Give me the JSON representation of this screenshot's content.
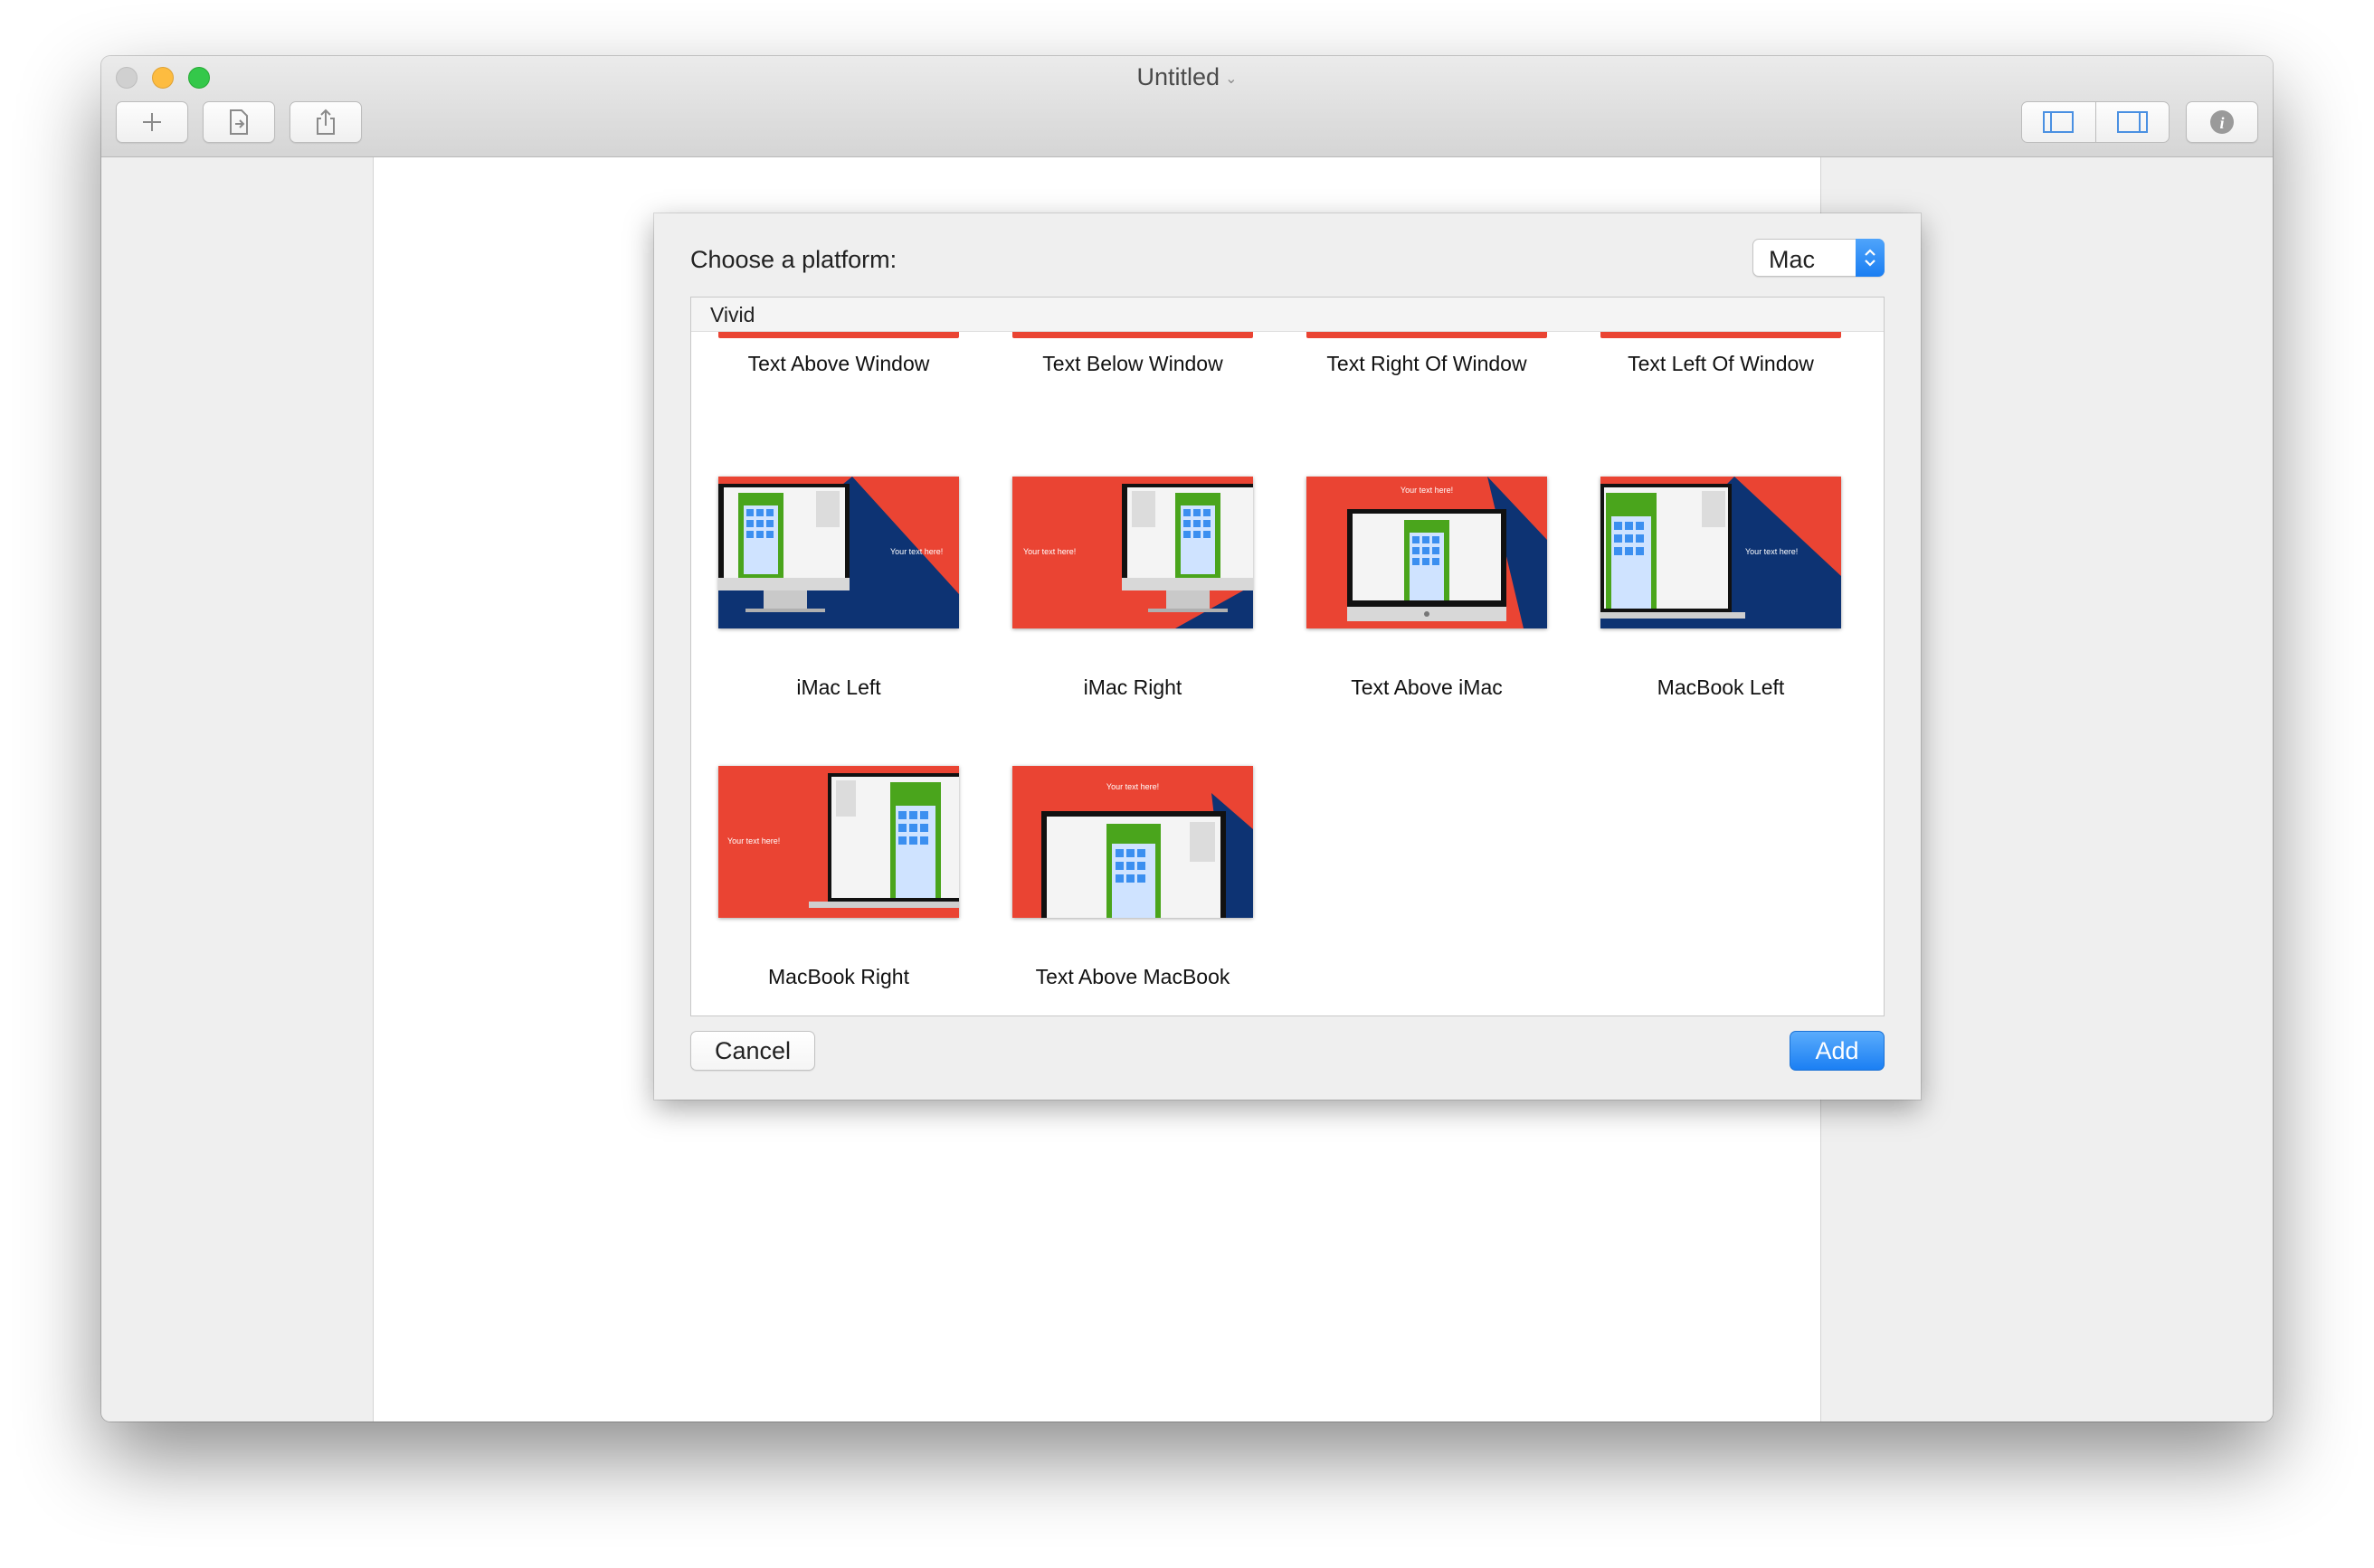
{
  "window": {
    "title": "Untitled"
  },
  "toolbar": {
    "add_icon": "plus-icon",
    "export_icon": "export-document-icon",
    "share_icon": "share-icon",
    "left_panel_icon": "left-sidebar-icon",
    "right_panel_icon": "right-sidebar-icon",
    "info_icon": "info-icon"
  },
  "sheet": {
    "label": "Choose a platform:",
    "platform": "Mac",
    "group": "Vivid",
    "cancel_label": "Cancel",
    "add_label": "Add",
    "top_row": [
      "Text Above Window",
      "Text Below Window",
      "Text Right Of Window",
      "Text Left Of Window"
    ],
    "templates": [
      {
        "label": "iMac Left",
        "caption": "Your text here!"
      },
      {
        "label": "iMac Right",
        "caption": "Your text here!"
      },
      {
        "label": "Text Above iMac",
        "caption": "Your text here!"
      },
      {
        "label": "MacBook Left",
        "caption": "Your text here!"
      },
      {
        "label": "MacBook Right",
        "caption": "Your text here!"
      },
      {
        "label": "Text Above MacBook",
        "caption": "Your text here!"
      }
    ]
  },
  "colors": {
    "red": "#ea4433",
    "navy": "#0d3373",
    "green": "#4aa51c",
    "accent": "#1b7ff3"
  }
}
